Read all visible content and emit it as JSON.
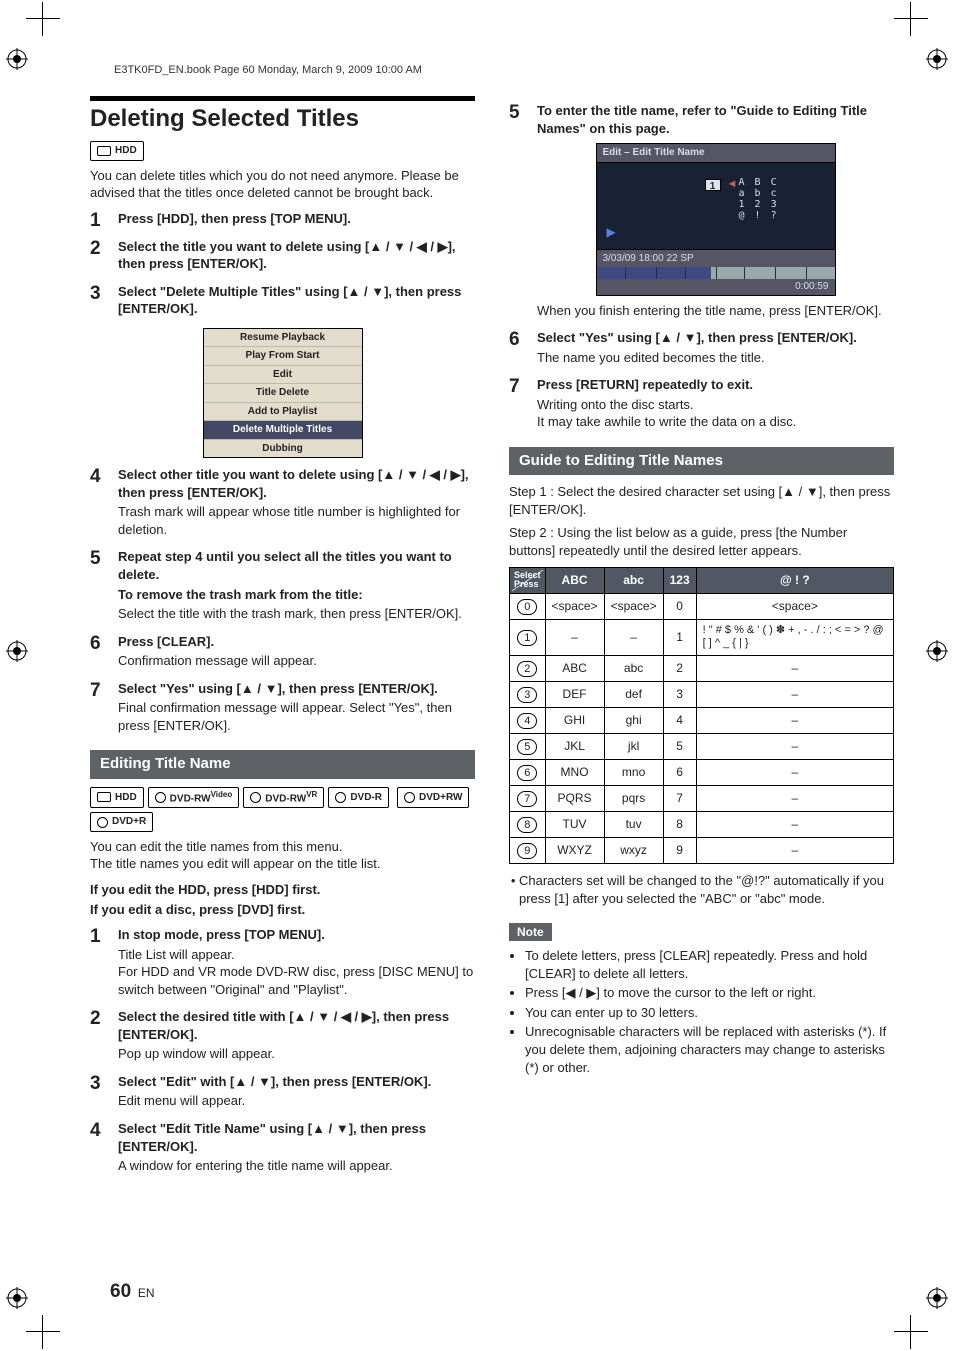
{
  "runhead": "E3TK0FD_EN.book  Page 60  Monday, March 9, 2009  10:00 AM",
  "page_number": "60",
  "page_lang": "EN",
  "left": {
    "section1": {
      "title": "Deleting Selected Titles",
      "media": [
        "HDD"
      ],
      "intro": "You can delete titles which you do not need anymore. Please be advised that the titles once deleted cannot be brought back.",
      "steps": [
        {
          "lead": "Press [HDD], then press [TOP MENU]."
        },
        {
          "lead": "Select the title you want to delete using [▲ / ▼ / ◀ / ▶], then press [ENTER/OK]."
        },
        {
          "lead": "Select \"Delete Multiple Titles\" using [▲ / ▼], then press [ENTER/OK]."
        },
        {
          "lead": "Select other title you want to delete using [▲ / ▼ / ◀ / ▶], then press [ENTER/OK].",
          "sub": "Trash mark will appear whose title number is highlighted for deletion."
        },
        {
          "lead": "Repeat step 4 until you select all the titles you want to delete.",
          "sub_bold": "To remove the trash mark from the title:",
          "sub": "Select the title with the trash mark, then press [ENTER/OK]."
        },
        {
          "lead": "Press [CLEAR].",
          "sub": "Confirmation message will appear."
        },
        {
          "lead": "Select \"Yes\" using [▲ / ▼], then press [ENTER/OK].",
          "sub": "Final confirmation message will appear. Select \"Yes\", then press [ENTER/OK]."
        }
      ],
      "popup": [
        "Resume Playback",
        "Play From Start",
        "Edit",
        "Title Delete",
        "Add to Playlist",
        "Delete Multiple Titles",
        "Dubbing"
      ],
      "popup_selected": "Delete Multiple Titles"
    },
    "section2": {
      "title": "Editing Title Name",
      "media": [
        "HDD",
        "DVD-RW Video",
        "DVD-RW VR",
        "DVD-R",
        "DVD+RW",
        "DVD+R"
      ],
      "intro": "You can edit the title names from this menu.\nThe title names you edit will appear on the title list.",
      "pre1": "If you edit the HDD, press [HDD] first.",
      "pre2": "If you edit a disc, press [DVD] first.",
      "steps": [
        {
          "lead": "In stop mode, press [TOP MENU].",
          "sub": "Title List will appear.\nFor HDD and VR mode DVD-RW disc, press [DISC MENU] to switch between \"Original\" and \"Playlist\"."
        },
        {
          "lead": "Select the desired title with [▲ / ▼ / ◀ / ▶], then press [ENTER/OK].",
          "sub": "Pop up window will appear."
        },
        {
          "lead": "Select \"Edit\" with [▲ / ▼], then press [ENTER/OK].",
          "sub": "Edit menu will appear."
        },
        {
          "lead": "Select \"Edit Title Name\" using [▲ / ▼], then press [ENTER/OK].",
          "sub": "A window for entering the title name will appear."
        }
      ]
    }
  },
  "right": {
    "steps": [
      {
        "n": "5",
        "lead": "To enter the title name, refer to \"Guide to Editing Title Names\" on this page."
      },
      {
        "n": "6",
        "lead": "Select \"Yes\" using [▲ / ▼], then press [ENTER/OK].",
        "sub": "The name you edited becomes the title."
      },
      {
        "n": "7",
        "lead": "Press [RETURN] repeatedly to exit.",
        "sub": "Writing onto the disc starts.\nIt may take awhile to write the data on a disc."
      }
    ],
    "ui": {
      "title": "Edit – Edit Title Name",
      "input": "1",
      "grid_rows": [
        "A B C",
        "a b c",
        "1 2 3",
        "@ ! ?"
      ],
      "foot": "3/03/09  18:00  22  SP",
      "time": "0:00:59"
    },
    "after_ui": "When you finish entering the title name, press [ENTER/OK].",
    "guide": {
      "title": "Guide to Editing Title Names",
      "step1": "Step 1 : Select the desired character set using [▲ / ▼], then press [ENTER/OK].",
      "step2": "Step 2 : Using the list below as a guide, press [the Number buttons] repeatedly until the desired letter appears.",
      "corner_top": "Select",
      "corner_bottom": "Press",
      "headers": [
        "ABC",
        "abc",
        "123",
        "@ ! ?"
      ],
      "rows": [
        {
          "k": "0",
          "c": [
            "<space>",
            "<space>",
            "0",
            "<space>"
          ]
        },
        {
          "k": "1",
          "c": [
            "–",
            "–",
            "1",
            "! \" # $ % & ' ( ) ✽ + , - . / : ; < = > ? @ [ ] ^ _ { | }"
          ]
        },
        {
          "k": "2",
          "c": [
            "ABC",
            "abc",
            "2",
            "–"
          ]
        },
        {
          "k": "3",
          "c": [
            "DEF",
            "def",
            "3",
            "–"
          ]
        },
        {
          "k": "4",
          "c": [
            "GHI",
            "ghi",
            "4",
            "–"
          ]
        },
        {
          "k": "5",
          "c": [
            "JKL",
            "jkl",
            "5",
            "–"
          ]
        },
        {
          "k": "6",
          "c": [
            "MNO",
            "mno",
            "6",
            "–"
          ]
        },
        {
          "k": "7",
          "c": [
            "PQRS",
            "pqrs",
            "7",
            "–"
          ]
        },
        {
          "k": "8",
          "c": [
            "TUV",
            "tuv",
            "8",
            "–"
          ]
        },
        {
          "k": "9",
          "c": [
            "WXYZ",
            "wxyz",
            "9",
            "–"
          ]
        }
      ],
      "after": "Characters set will be changed to the \"@!?\" automatically if you press [1] after you selected the \"ABC\" or \"abc\" mode.",
      "note_label": "Note",
      "notes": [
        "To delete letters, press [CLEAR] repeatedly. Press and hold [CLEAR] to delete all letters.",
        "Press [◀ / ▶] to move the cursor to the left or right.",
        "You can enter up to 30 letters.",
        "Unrecognisable characters will be replaced with asterisks (*). If you delete them, adjoining characters may change to asterisks (*) or other."
      ]
    }
  }
}
